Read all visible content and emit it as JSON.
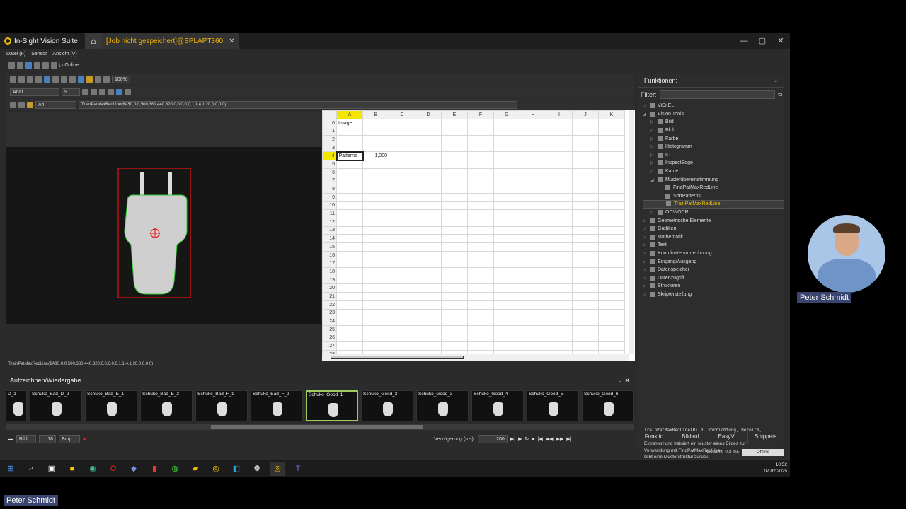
{
  "window": {
    "app_title": "In-Sight Vision Suite",
    "tab_title": "[Job nicht gespeichert]@SPLAPT360",
    "tab_close": "✕",
    "controls": [
      "—",
      "▢",
      "✕"
    ]
  },
  "menu": [
    "Datei (F)",
    "Sensor",
    "Ansicht (V)"
  ],
  "toolbar": {
    "online_label": "Online",
    "zoom": "100%",
    "font": "Arial",
    "font_size": "9",
    "cell_ref": "A4"
  },
  "formula_bar": "TrainPatMaxRedLine($A$0,0,0,500,380,440,320,0,0,0,0,0,1,1,4,1,20,0,0,0,0)",
  "spreadsheet": {
    "columns": [
      "A",
      "B",
      "C",
      "D",
      "E",
      "F",
      "G",
      "H",
      "I",
      "J",
      "K"
    ],
    "rows": [
      "0",
      "1",
      "2",
      "3",
      "4",
      "5",
      "6",
      "7",
      "8",
      "9",
      "10",
      "11",
      "12",
      "13",
      "14",
      "15",
      "16",
      "17",
      "18",
      "19",
      "20",
      "21",
      "22",
      "23",
      "24",
      "25",
      "26",
      "27",
      "28"
    ],
    "cell_A0": "Image",
    "cell_A4": "Patterns",
    "cell_B4": "1,000"
  },
  "status_formula": "TrainPatMaxRedLine($A$0,0,0,500,380,440,320,0,0,0,0,0,1,1,4,1,20,0,0,0,0)",
  "functions_panel": {
    "title": "Funktionen:",
    "filter_label": "Filter:",
    "tree": [
      {
        "label": "ViDi EL",
        "level": 0,
        "expanded": false
      },
      {
        "label": "Vision Tools",
        "level": 0,
        "expanded": true
      },
      {
        "label": "Bild",
        "level": 1,
        "expanded": false
      },
      {
        "label": "Blob",
        "level": 1,
        "expanded": false
      },
      {
        "label": "Farbe",
        "level": 1,
        "expanded": false
      },
      {
        "label": "Histogramm",
        "level": 1,
        "expanded": false
      },
      {
        "label": "ID",
        "level": 1,
        "expanded": false
      },
      {
        "label": "InspectEdge",
        "level": 1,
        "expanded": false
      },
      {
        "label": "Kante",
        "level": 1,
        "expanded": false
      },
      {
        "label": "Musterübereinstimmung",
        "level": 1,
        "expanded": true
      },
      {
        "label": "FindPatMaxRedLine",
        "level": 2
      },
      {
        "label": "SortPatterns",
        "level": 2
      },
      {
        "label": "TrainPatMaxRedLine",
        "level": 2,
        "selected": true
      },
      {
        "label": "OCV/OCR",
        "level": 1,
        "expanded": false
      },
      {
        "label": "Geometrische Elemente",
        "level": 0,
        "expanded": false
      },
      {
        "label": "Grafiken",
        "level": 0,
        "expanded": false
      },
      {
        "label": "Mathematik",
        "level": 0,
        "expanded": false
      },
      {
        "label": "Text",
        "level": 0,
        "expanded": false
      },
      {
        "label": "Koordinatenumrechnung",
        "level": 0,
        "expanded": false
      },
      {
        "label": "Eingang/Ausgang",
        "level": 0,
        "expanded": false
      },
      {
        "label": "Datenspeicher",
        "level": 0,
        "expanded": false
      },
      {
        "label": "Datenzugriff",
        "level": 0,
        "expanded": false
      },
      {
        "label": "Strukturen",
        "level": 0,
        "expanded": false
      },
      {
        "label": "Skripterstellung",
        "level": 0,
        "expanded": false
      }
    ],
    "desc_signature": "TrainPatMaxRedLine(Bild, Vorrichtung, Bereich, ...)",
    "desc_text_1": "Extrahiert und trainiert ein Muster eines Bildes zur",
    "desc_text_2": "Verwendung mit FindPatMaxRedLine.",
    "desc_text_3": "Gibt eine Musterstruktur zurück.",
    "tabs": [
      "Funktio...",
      "Bildauf...",
      "EasyVi...",
      "Snippets"
    ]
  },
  "recording": {
    "title": "Aufzeichnen/Wiedergabe",
    "thumbnails": [
      "D_1",
      "Schuko_Bad_D_2",
      "Schuko_Bad_E_1",
      "Schuko_Bad_E_2",
      "Schuko_Bad_F_1",
      "Schuko_Bad_F_2",
      "Schuko_Good_1",
      "Schuko_Good_2",
      "Schuko_Good_3",
      "Schuko_Good_4",
      "Schuko_Good_5",
      "Schuko_Good_6"
    ],
    "active_index": 6,
    "source": "Bild",
    "frame": "18",
    "format": "Bmp",
    "delay_label": "Verzögerung (ms):",
    "delay_value": "200"
  },
  "status": {
    "total": "Gesamt: 0.2 ms",
    "state": "Offline"
  },
  "clock": {
    "time": "10:52",
    "date": "07.02.2025"
  },
  "participant": {
    "name": "Peter Schmidt"
  }
}
